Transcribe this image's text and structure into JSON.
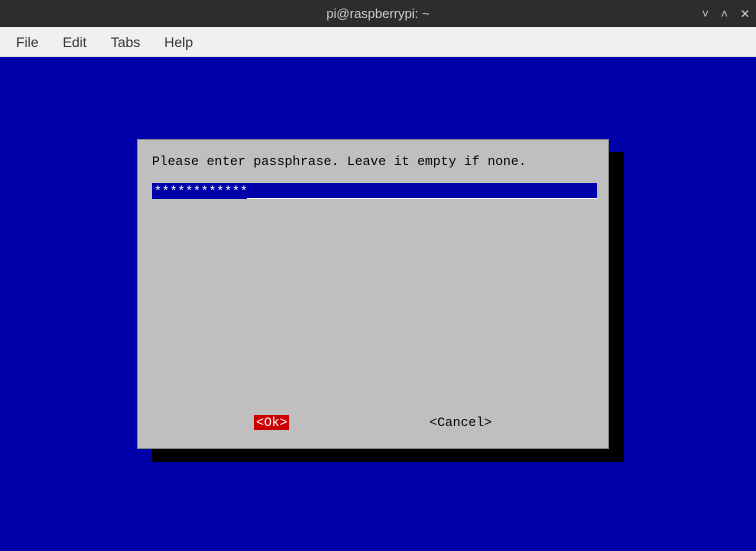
{
  "titlebar": {
    "title": "pi@raspberrypi: ~",
    "min": "˅",
    "max": "˄",
    "close": "✕"
  },
  "menubar": {
    "file": "File",
    "edit": "Edit",
    "tabs": "Tabs",
    "help": "Help"
  },
  "dialog": {
    "prompt": "Please enter passphrase. Leave it empty if none.",
    "masked_value": "************",
    "ok_label": "<Ok>",
    "cancel_label": "<Cancel>"
  }
}
